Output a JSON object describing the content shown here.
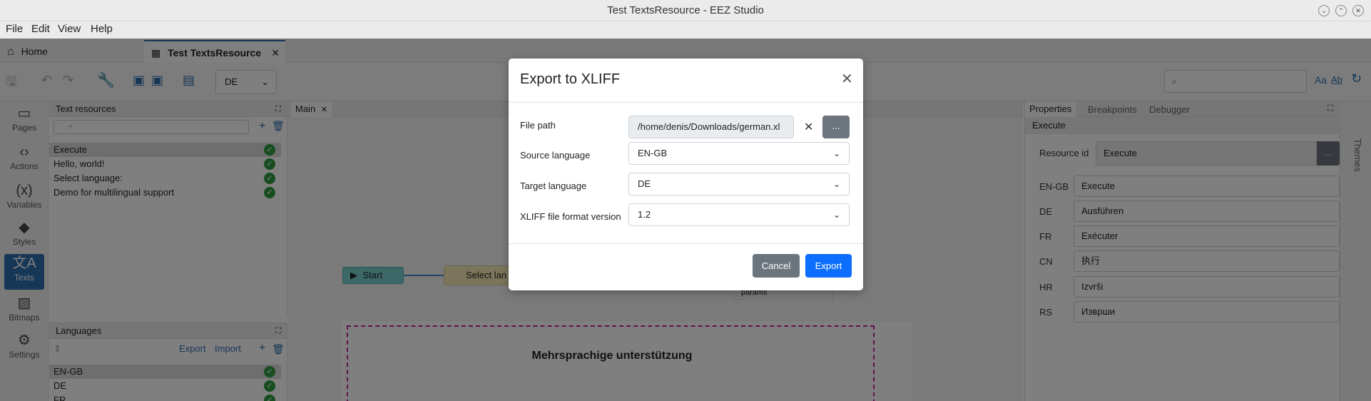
{
  "window": {
    "title": "Test TextsResource - EEZ Studio"
  },
  "menu": [
    "File",
    "Edit",
    "View",
    "Help"
  ],
  "tabs": {
    "home": "Home",
    "active": "Test TextsResource"
  },
  "toolbar": {
    "language": "DE"
  },
  "sidebar": [
    {
      "label": "Pages",
      "icon": "pages-icon"
    },
    {
      "label": "Actions",
      "icon": "actions-icon"
    },
    {
      "label": "Variables",
      "icon": "variables-icon"
    },
    {
      "label": "Styles",
      "icon": "styles-icon"
    },
    {
      "label": "Texts",
      "icon": "texts-icon"
    },
    {
      "label": "Bitmaps",
      "icon": "bitmaps-icon"
    },
    {
      "label": "Settings",
      "icon": "settings-icon"
    }
  ],
  "text_resources": {
    "title": "Text resources",
    "items": [
      "Execute",
      "Hello, world!",
      "Select language:",
      "Demo for multilingual support"
    ]
  },
  "languages": {
    "title": "Languages",
    "export_label": "Export",
    "import_label": "Import",
    "items": [
      "EN-GB",
      "DE",
      "FR"
    ]
  },
  "editor": {
    "tab": "Main",
    "start_node": "Start",
    "select_node": "Select lan",
    "params_label": "params",
    "page_heading": "Mehrsprachige unterstützung"
  },
  "right_panel": {
    "tabs": [
      "Properties",
      "Breakpoints",
      "Debugger"
    ],
    "themes_label": "Themes",
    "selected": "Execute",
    "resource_id_label": "Resource id",
    "resource_id": "Execute",
    "translations": [
      {
        "lang": "EN-GB",
        "text": "Execute"
      },
      {
        "lang": "DE",
        "text": "Ausführen"
      },
      {
        "lang": "FR",
        "text": "Exécuter"
      },
      {
        "lang": "CN",
        "text": "执行"
      },
      {
        "lang": "HR",
        "text": "Izvrši"
      },
      {
        "lang": "RS",
        "text": "Изврши"
      }
    ]
  },
  "dialog": {
    "title": "Export to XLIFF",
    "file_path_label": "File path",
    "file_path": "/home/denis/Downloads/german.xl",
    "browse_label": "...",
    "source_language_label": "Source language",
    "source_language": "EN-GB",
    "target_language_label": "Target language",
    "target_language": "DE",
    "format_version_label": "XLIFF file format version",
    "format_version": "1.2",
    "cancel_label": "Cancel",
    "export_label": "Export"
  },
  "colors": {
    "accent": "#0d6efd",
    "secondary": "#6c757d",
    "check": "#2e9b3f",
    "sidebar_active": "#2f6fad"
  }
}
